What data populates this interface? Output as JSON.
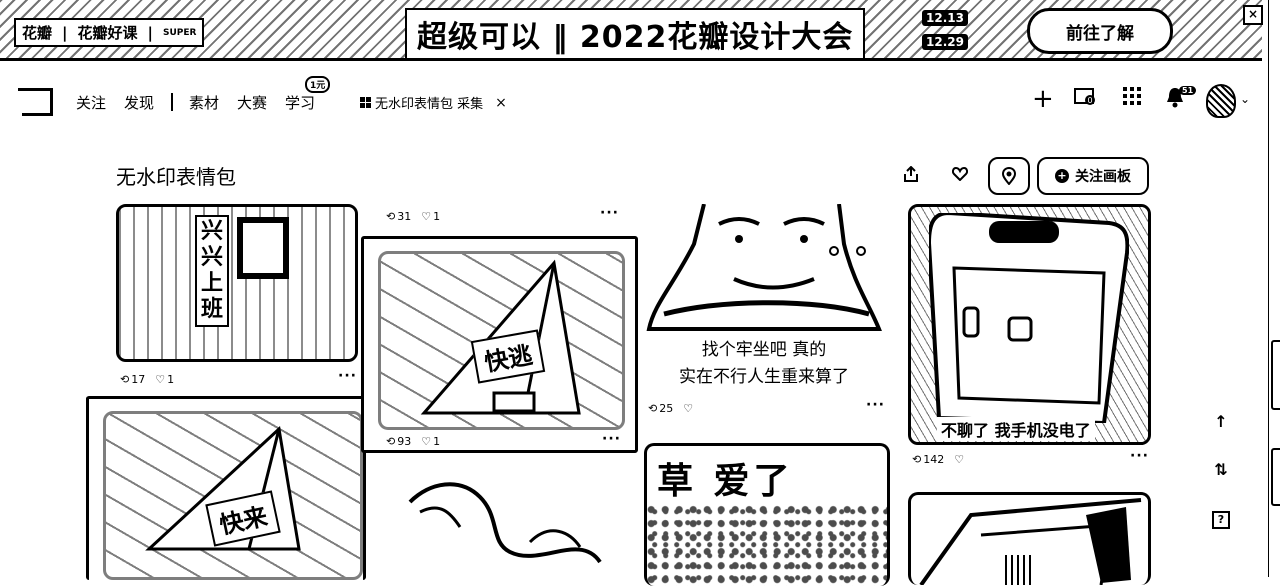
{
  "banner": {
    "logo_1": "花瓣",
    "logo_2": "花瓣好课",
    "logo_3": "SUPER",
    "title": "超级可以 ‖ 2022花瓣设计大会",
    "date_start": "12.13",
    "date_end": "12.29",
    "cta": "前往了解",
    "close": "×"
  },
  "nav": {
    "links": [
      "关注",
      "发现",
      "素材",
      "大赛",
      "学习"
    ],
    "learn_badge": "1元",
    "board_tag": "无水印表情包 采集",
    "board_tag_close": "×",
    "icons": [
      "plus-icon",
      "upload-icon",
      "apps-icon",
      "bell-icon"
    ],
    "bell_count": "51"
  },
  "board": {
    "title": "无水印表情包",
    "follow_label": "关注画板"
  },
  "pins": [
    {
      "text": "兴兴上班",
      "repins": "17",
      "likes": "1"
    },
    {
      "text": "快逃",
      "repins": "31",
      "likes": "1"
    },
    {
      "text": "快逃",
      "repins": "93",
      "likes": "1"
    },
    {
      "text": "找个牢坐吧   真的\n实在不行人生重来算了",
      "line1": "找个牢坐吧   真的",
      "line2": "实在不行人生重来算了",
      "repins": "25",
      "likes": ""
    },
    {
      "text": "不聊了 我手机没电了",
      "repins": "142",
      "likes": ""
    },
    {
      "text": "快来",
      "repins": "",
      "likes": ""
    },
    {
      "text": "草 爱了",
      "repins": "",
      "likes": ""
    }
  ],
  "rail": {
    "top": "↑",
    "filter": "⇅",
    "help": "?"
  },
  "more_label": "···"
}
